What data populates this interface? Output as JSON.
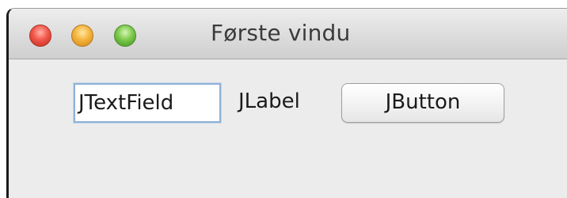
{
  "window": {
    "title": "Første vindu"
  },
  "titlebar": {
    "buttons": [
      {
        "name": "close",
        "color": "#f2564a"
      },
      {
        "name": "minimize",
        "color": "#f5b43e"
      },
      {
        "name": "zoom",
        "color": "#7cc94b"
      }
    ]
  },
  "content": {
    "textfield_value": "JTextField",
    "label_text": "JLabel",
    "button_label": "JButton"
  }
}
